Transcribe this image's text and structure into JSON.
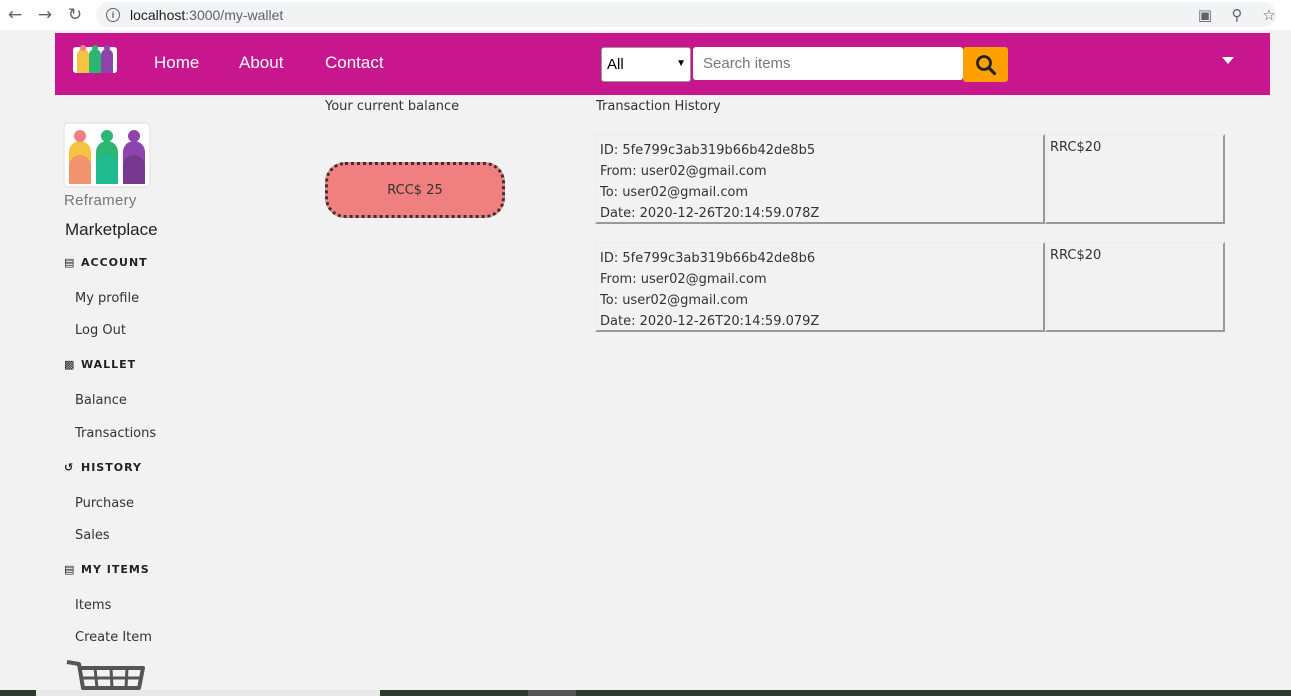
{
  "browser": {
    "url_host": "localhost",
    "url_rest": ":3000/my-wallet"
  },
  "nav": {
    "links": [
      "Home",
      "About",
      "Contact"
    ],
    "search_category": "All",
    "search_placeholder": "Search items"
  },
  "sidebar": {
    "brand_word": "Reframery",
    "brand_title": "Marketplace",
    "sections": [
      {
        "title": "ACCOUNT",
        "icon": "id-card-icon",
        "items": [
          "My profile",
          "Log Out"
        ]
      },
      {
        "title": "WALLET",
        "icon": "wallet-icon",
        "items": [
          "Balance",
          "Transactions"
        ]
      },
      {
        "title": "HISTORY",
        "icon": "history-icon",
        "items": [
          "Purchase",
          "Sales"
        ]
      },
      {
        "title": "MY ITEMS",
        "icon": "list-icon",
        "items": [
          "Items",
          "Create Item"
        ]
      }
    ]
  },
  "wallet": {
    "balance_label": "Your current balance",
    "balance_value": "RCC$ 25",
    "history_label": "Transaction History",
    "transactions": [
      {
        "id": "ID: 5fe799c3ab319b66b42de8b5",
        "from": "From: user02@gmail.com",
        "to": "To: user02@gmail.com",
        "date": "Date: 2020-12-26T20:14:59.078Z",
        "amount": "RRC$20"
      },
      {
        "id": "ID: 5fe799c3ab319b66b42de8b6",
        "from": "From: user02@gmail.com",
        "to": "To: user02@gmail.com",
        "date": "Date: 2020-12-26T20:14:59.079Z",
        "amount": "RRC$20"
      }
    ]
  },
  "colors": {
    "nav_bg": "#c7168e",
    "search_btn": "#ff9f00",
    "balance_pill": "#f08080"
  }
}
